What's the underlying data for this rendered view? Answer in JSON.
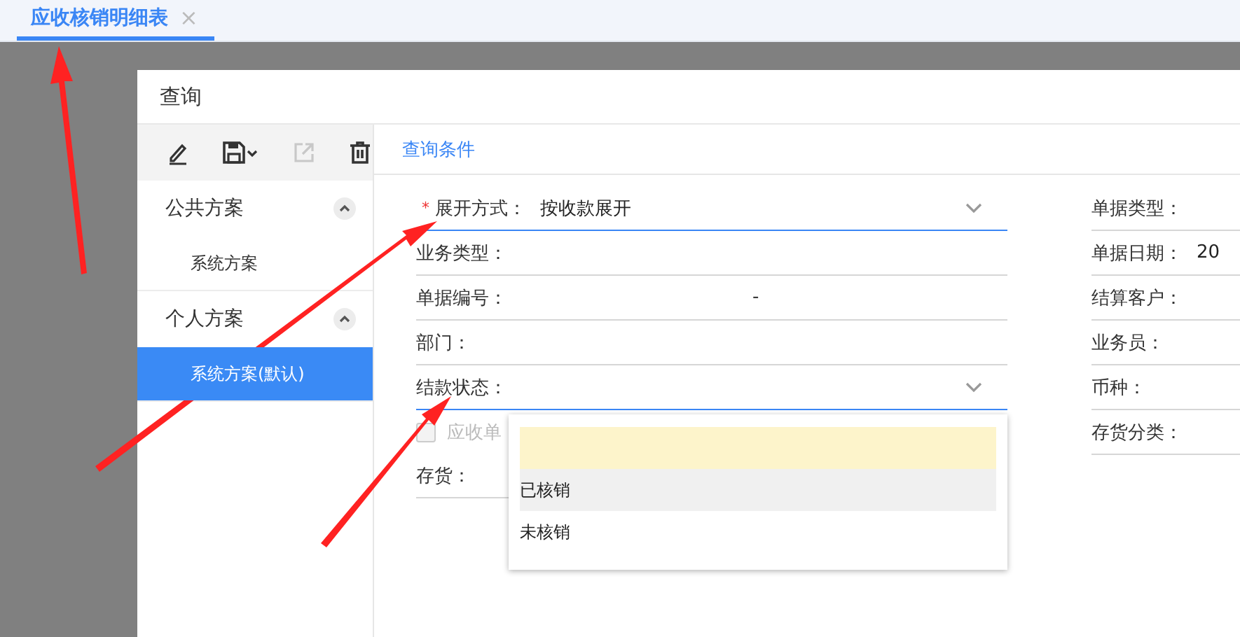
{
  "tabs": [
    {
      "label": "应收核销明细表",
      "selected": true,
      "close": "×"
    }
  ],
  "dialog": {
    "title": "查询",
    "toolbar": [
      {
        "disabled": false
      },
      {
        "disabled": false
      },
      {
        "disabled": true
      },
      {
        "disabled": false
      }
    ],
    "scheme_groups": [
      {
        "label": "公共方案",
        "expanded": true,
        "items": [
          {
            "label": "系统方案",
            "selected": false
          }
        ]
      },
      {
        "label": "个人方案",
        "expanded": true,
        "items": [
          {
            "label": "系统方案(默认)",
            "selected": true
          }
        ]
      }
    ],
    "condition_tab": "查询条件",
    "left_fields": [
      {
        "kind": "select",
        "label": "展开方式：",
        "required_mark": "*",
        "value": "按收款展开",
        "active": true
      },
      {
        "kind": "text",
        "label": "业务类型：",
        "active": false
      },
      {
        "kind": "range",
        "label": "单据编号：",
        "separator": "-",
        "active": false
      },
      {
        "kind": "text",
        "label": "部门：",
        "active": false
      },
      {
        "kind": "select",
        "label": "结款状态：",
        "active": true
      },
      {
        "kind": "checkbox",
        "label": "应收单",
        "checked": false,
        "disabled": true
      },
      {
        "kind": "text",
        "label": "存货：",
        "active": false
      }
    ],
    "right_fields": [
      {
        "label": "单据类型："
      },
      {
        "label": "单据日期：",
        "value": "20"
      },
      {
        "label": "结算客户："
      },
      {
        "label": "业务员："
      },
      {
        "label": "币种："
      },
      {
        "label": "存货分类："
      }
    ],
    "dropdown": {
      "options": [
        {
          "label": "已核销",
          "hovered": true
        },
        {
          "label": "未核销",
          "hovered": false
        }
      ]
    }
  }
}
